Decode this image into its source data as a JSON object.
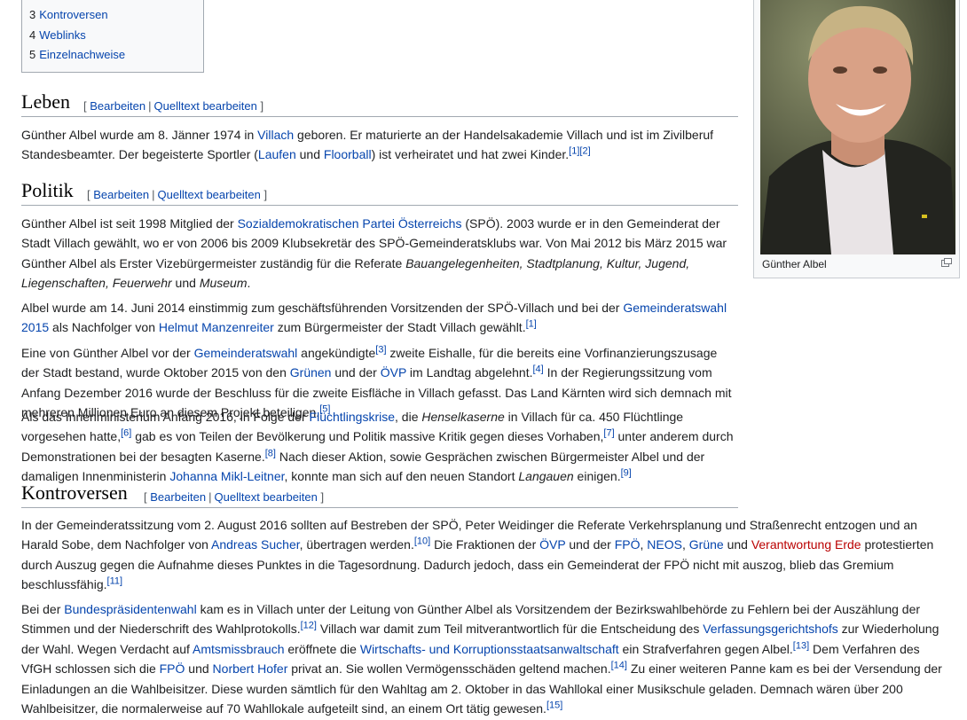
{
  "toc": [
    {
      "num": "3",
      "label": "Kontroversen"
    },
    {
      "num": "4",
      "label": "Weblinks"
    },
    {
      "num": "5",
      "label": "Einzelnachweise"
    }
  ],
  "infobox": {
    "caption": "Günther Albel"
  },
  "edit": {
    "bearbeiten": "Bearbeiten",
    "quelltext": "Quelltext bearbeiten",
    "open": "[",
    "close": "]",
    "sep": "|"
  },
  "sections": {
    "leben": "Leben",
    "politik": "Politik",
    "kontroversen": "Kontroversen"
  },
  "text": {
    "l1a": "Günther Albel wurde am 8. Jänner 1974 in ",
    "l1_villach": "Villach",
    "l1b": " geboren. Er maturierte an der Handelsakademie Villach und ist im Zivilberuf Standesbeamter. Der begeisterte Sportler (",
    "l1_laufen": "Laufen",
    "l1_und": " und ",
    "l1_floorball": "Floorball",
    "l1c": ") ist verheiratet und hat zwei Kinder.",
    "r1": "[1]",
    "r2": "[2]",
    "r3": "[3]",
    "r4": "[4]",
    "r5": "[5]",
    "r6": "[6]",
    "r7": "[7]",
    "r8": "[8]",
    "r9": "[9]",
    "r10": "[10]",
    "r11": "[11]",
    "r12": "[12]",
    "r13": "[13]",
    "r14": "[14]",
    "r15": "[15]",
    "p1a": "Günther Albel ist seit 1998 Mitglied der ",
    "p1_spoe": "Sozialdemokratischen Partei Österreichs",
    "p1b": " (SPÖ). 2003 wurde er in den Gemeinderat der Stadt Villach gewählt, wo er von 2006 bis 2009 Klubsekretär des SPÖ-Gemeinderatsklubs war. Von Mai 2012 bis März 2015 war Günther Albel als Erster Vizebürgermeister zuständig für die Referate ",
    "p1_it": "Bauangelegenheiten, Stadtplanung, Kultur, Jugend, Liegenschaften, Feuerwehr",
    "p1_und": " und ",
    "p1_museum": "Museum",
    "p1_dot": ".",
    "p2a": "Albel wurde am 14. Juni 2014 einstimmig zum geschäftsführenden Vorsitzenden der SPÖ-Villach und bei der ",
    "p2_gw": "Gemeinderatswahl 2015",
    "p2b": " als Nachfolger von ",
    "p2_hm": "Helmut Manzenreiter",
    "p2c": " zum Bürgermeister der Stadt Villach gewählt.",
    "p3a": "Eine von Günther Albel vor der ",
    "p3_gw": "Gemeinderatswahl",
    "p3b": " angekündigte",
    "p3c": " zweite Eishalle, für die bereits eine Vorfinanzierungszusage der Stadt bestand, wurde Oktober 2015 von den ",
    "p3_gruene": "Grünen",
    "p3d": " und der ",
    "p3_oevp": "ÖVP",
    "p3e": " im Landtag abgelehnt.",
    "p3f": " In der Regierungssitzung vom Anfang Dezember 2016 wurde der Beschluss für die zweite Eisfläche in Villach gefasst. Das Land Kärnten wird sich demnach mit mehreren Millionen Euro an diesem Projekt beteiligen.",
    "p4a": "Als das Innenministerium Anfang 2016, in Folge der ",
    "p4_fk": "Flüchtlingskrise",
    "p4b": ", die ",
    "p4_hk": "Henselkaserne",
    "p4c": " in Villach für ca. 450 Flüchtlinge vorgesehen hatte,",
    "p4d": " gab es von Teilen der Bevölkerung und Politik massive Kritik gegen dieses Vorhaben,",
    "p4e": " unter anderem durch Demonstrationen bei der besagten Kaserne.",
    "p4f": " Nach dieser Aktion, sowie Gesprächen zwischen Bürgermeister Albel und der damaligen Innenministerin ",
    "p4_jml": "Johanna Mikl-Leitner",
    "p4g": ", konnte man sich auf den neuen Standort ",
    "p4_lang": "Langauen",
    "p4h": " einigen.",
    "k1a": "In der Gemeinderatssitzung vom 2. August 2016 sollten auf Bestreben der SPÖ, Peter Weidinger die Referate Verkehrsplanung und Straßenrecht entzogen und an Harald Sobe, dem Nachfolger von ",
    "k1_as": "Andreas Sucher",
    "k1b": ", übertragen werden.",
    "k1c": " Die Fraktionen der ",
    "k1_oevp": "ÖVP",
    "k1d": " und der ",
    "k1_fpoe": "FPÖ",
    "k1e": ", ",
    "k1_neos": "NEOS",
    "k1f": ", ",
    "k1_gruene": "Grüne",
    "k1g": " und ",
    "k1_ve": "Verantwortung Erde",
    "k1h": " protestierten durch Auszug gegen die Aufnahme dieses Punktes in die Tagesordnung. Dadurch jedoch, dass ein Gemeinderat der FPÖ nicht mit auszog, blieb das Gremium beschlussfähig.",
    "k2a": "Bei der ",
    "k2_bpw": "Bundespräsidentenwahl",
    "k2b": " kam es in Villach unter der Leitung von Günther Albel als Vorsitzendem der Bezirkswahlbehörde zu Fehlern bei der Auszählung der Stimmen und der Niederschrift des Wahlprotokolls.",
    "k2c": " Villach war damit zum Teil mitverantwortlich für die Entscheidung des ",
    "k2_vgh": "Verfassungsgerichtshofs",
    "k2d": " zur Wiederholung der Wahl. Wegen Verdacht auf ",
    "k2_amb": "Amtsmissbrauch",
    "k2e": " eröffnete die ",
    "k2_wksta": "Wirtschafts- und Korruptionsstaatsanwaltschaft",
    "k2f": " ein Strafverfahren gegen Albel.",
    "k2g": " Dem Verfahren des VfGH schlossen sich die ",
    "k2_fpoe": "FPÖ",
    "k2h": " und ",
    "k2_nh": "Norbert Hofer",
    "k2i": " privat an. Sie wollen Vermögensschäden geltend machen.",
    "k2j": " Zu einer weiteren Panne kam es bei der Versendung der Einladungen an die Wahlbeisitzer. Diese wurden sämtlich für den Wahltag am 2. Oktober in das Wahllokal einer Musikschule geladen. Demnach wären über 200 Wahlbeisitzer, die normalerweise auf 70 Wahllokale aufgeteilt sind, an einem Ort tätig gewesen."
  }
}
